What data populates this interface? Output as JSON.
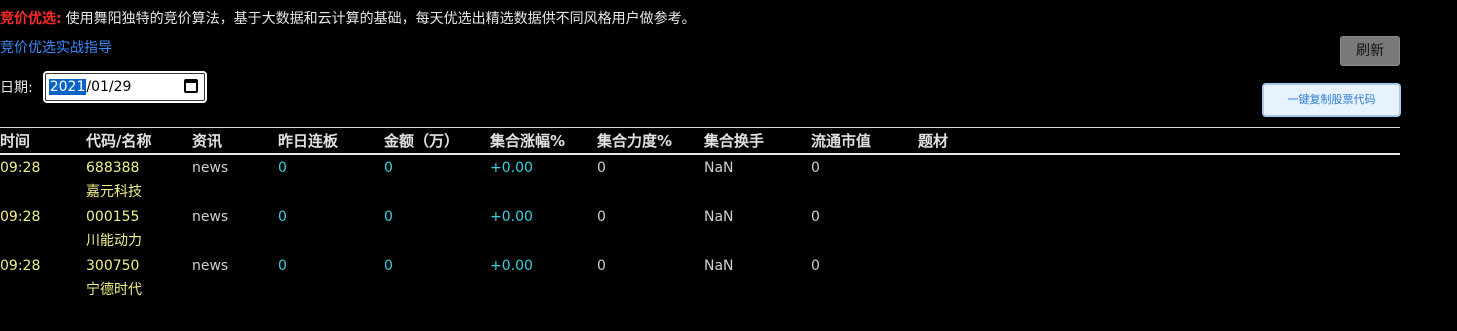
{
  "intro": {
    "label": "竞价优选:",
    "text": "使用舞阳独特的竞价算法，基于大数据和云计算的基础，每天优选出精选数据供不同风格用户做参考。"
  },
  "guide_link": "竞价优选实战指导",
  "refresh_label": "刷新",
  "date": {
    "label": "日期:",
    "year": "2021",
    "rest": "/01/29"
  },
  "copy_button_label": "一键复制股票代码",
  "table": {
    "headers": [
      "时间",
      "代码/名称",
      "资讯",
      "昨日连板",
      "金额（万）",
      "集合涨幅%",
      "集合力度%",
      "集合换手",
      "流通市值",
      "题材"
    ],
    "rows": [
      {
        "time": "09:28",
        "code": "688388",
        "name": "嘉元科技",
        "news": "news",
        "ban": "0",
        "amount": "0",
        "rise": "+0.00",
        "force": "0",
        "turnover": "NaN",
        "cap": "0",
        "theme": ""
      },
      {
        "time": "09:28",
        "code": "000155",
        "name": "川能动力",
        "news": "news",
        "ban": "0",
        "amount": "0",
        "rise": "+0.00",
        "force": "0",
        "turnover": "NaN",
        "cap": "0",
        "theme": ""
      },
      {
        "time": "09:28",
        "code": "300750",
        "name": "宁德时代",
        "news": "news",
        "ban": "0",
        "amount": "0",
        "rise": "+0.00",
        "force": "0",
        "turnover": "NaN",
        "cap": "0",
        "theme": ""
      }
    ]
  }
}
